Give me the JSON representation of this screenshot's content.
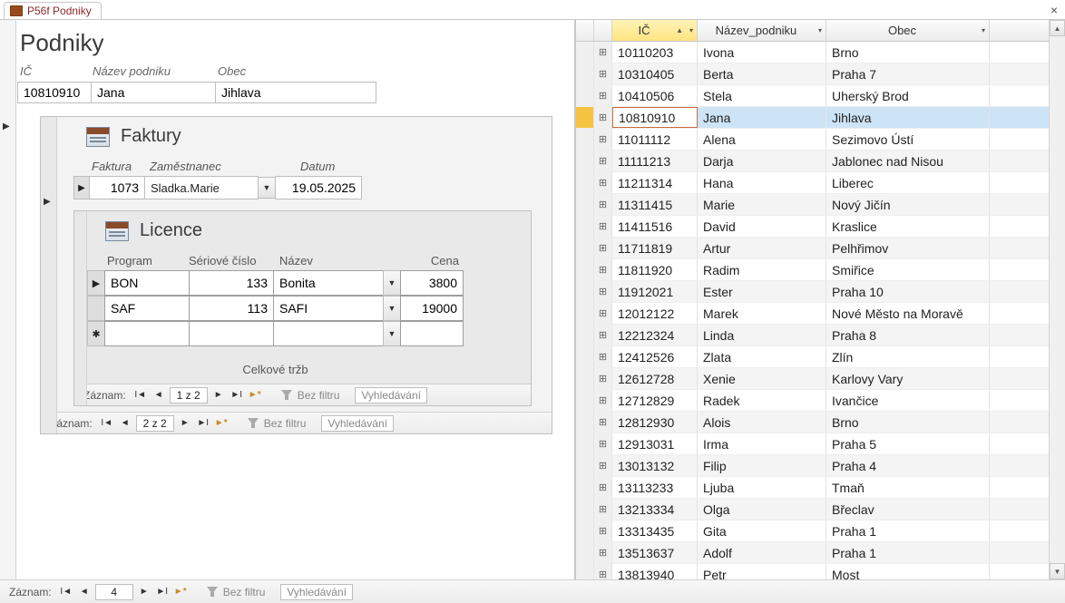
{
  "tab": {
    "title": "P56f Podniky"
  },
  "form": {
    "heading": "Podniky",
    "labels": {
      "ic": "IČ",
      "nazev": "Název podniku",
      "obec": "Obec"
    },
    "row": {
      "ic": "10810910",
      "nazev": "Jana",
      "obec": "Jihlava"
    }
  },
  "faktury": {
    "title": "Faktury",
    "labels": {
      "faktura": "Faktura",
      "zamestnanec": "Zaměstnanec",
      "datum": "Datum"
    },
    "row": {
      "faktura": "1073",
      "zamestnanec": "Sladka.Marie",
      "datum": "19.05.2025"
    },
    "nav": {
      "label": "Záznam:",
      "pos": "2 z 2",
      "filter": "Bez filtru",
      "search": "Vyhledávání"
    }
  },
  "licence": {
    "title": "Licence",
    "labels": {
      "program": "Program",
      "serial": "Sériové číslo",
      "nazev": "Název",
      "cena": "Cena"
    },
    "rows": [
      {
        "program": "BON",
        "serial": "133",
        "nazev": "Bonita",
        "cena": "3800"
      },
      {
        "program": "SAF",
        "serial": "113",
        "nazev": "SAFI",
        "cena": "19000"
      }
    ],
    "total_label": "Celkové tržb",
    "nav": {
      "label": "Záznam:",
      "pos": "1 z 2",
      "filter": "Bez filtru",
      "search": "Vyhledávání"
    }
  },
  "outer_nav": {
    "label": "Záznam:",
    "pos": "4",
    "filter": "Bez filtru",
    "search": "Vyhledávání"
  },
  "grid": {
    "headers": {
      "ic": "IČ",
      "nazev": "Název_podniku",
      "obec": "Obec"
    },
    "selected_ic": "10810910",
    "rows": [
      {
        "ic": "10110203",
        "nazev": "Ivona",
        "obec": "Brno"
      },
      {
        "ic": "10310405",
        "nazev": "Berta",
        "obec": "Praha 7"
      },
      {
        "ic": "10410506",
        "nazev": "Stela",
        "obec": "Uherský Brod"
      },
      {
        "ic": "10810910",
        "nazev": "Jana",
        "obec": "Jihlava"
      },
      {
        "ic": "11011112",
        "nazev": "Alena",
        "obec": "Sezimovo Ústí"
      },
      {
        "ic": "11111213",
        "nazev": "Darja",
        "obec": "Jablonec nad Nisou"
      },
      {
        "ic": "11211314",
        "nazev": "Hana",
        "obec": "Liberec"
      },
      {
        "ic": "11311415",
        "nazev": "Marie",
        "obec": "Nový Jičín"
      },
      {
        "ic": "11411516",
        "nazev": "David",
        "obec": "Kraslice"
      },
      {
        "ic": "11711819",
        "nazev": "Artur",
        "obec": "Pelhřimov"
      },
      {
        "ic": "11811920",
        "nazev": "Radim",
        "obec": "Smiřice"
      },
      {
        "ic": "11912021",
        "nazev": "Ester",
        "obec": "Praha 10"
      },
      {
        "ic": "12012122",
        "nazev": "Marek",
        "obec": "Nové Město na Moravě"
      },
      {
        "ic": "12212324",
        "nazev": "Linda",
        "obec": "Praha 8"
      },
      {
        "ic": "12412526",
        "nazev": "Zlata",
        "obec": "Zlín"
      },
      {
        "ic": "12612728",
        "nazev": "Xenie",
        "obec": "Karlovy Vary"
      },
      {
        "ic": "12712829",
        "nazev": "Radek",
        "obec": "Ivančice"
      },
      {
        "ic": "12812930",
        "nazev": "Alois",
        "obec": "Brno"
      },
      {
        "ic": "12913031",
        "nazev": "Irma",
        "obec": "Praha 5"
      },
      {
        "ic": "13013132",
        "nazev": "Filip",
        "obec": "Praha 4"
      },
      {
        "ic": "13113233",
        "nazev": "Ljuba",
        "obec": "Tmaň"
      },
      {
        "ic": "13213334",
        "nazev": "Olga",
        "obec": "Břeclav"
      },
      {
        "ic": "13313435",
        "nazev": "Gita",
        "obec": "Praha 1"
      },
      {
        "ic": "13513637",
        "nazev": "Adolf",
        "obec": "Praha 1"
      },
      {
        "ic": "13813940",
        "nazev": "Petr",
        "obec": "Most"
      }
    ]
  }
}
